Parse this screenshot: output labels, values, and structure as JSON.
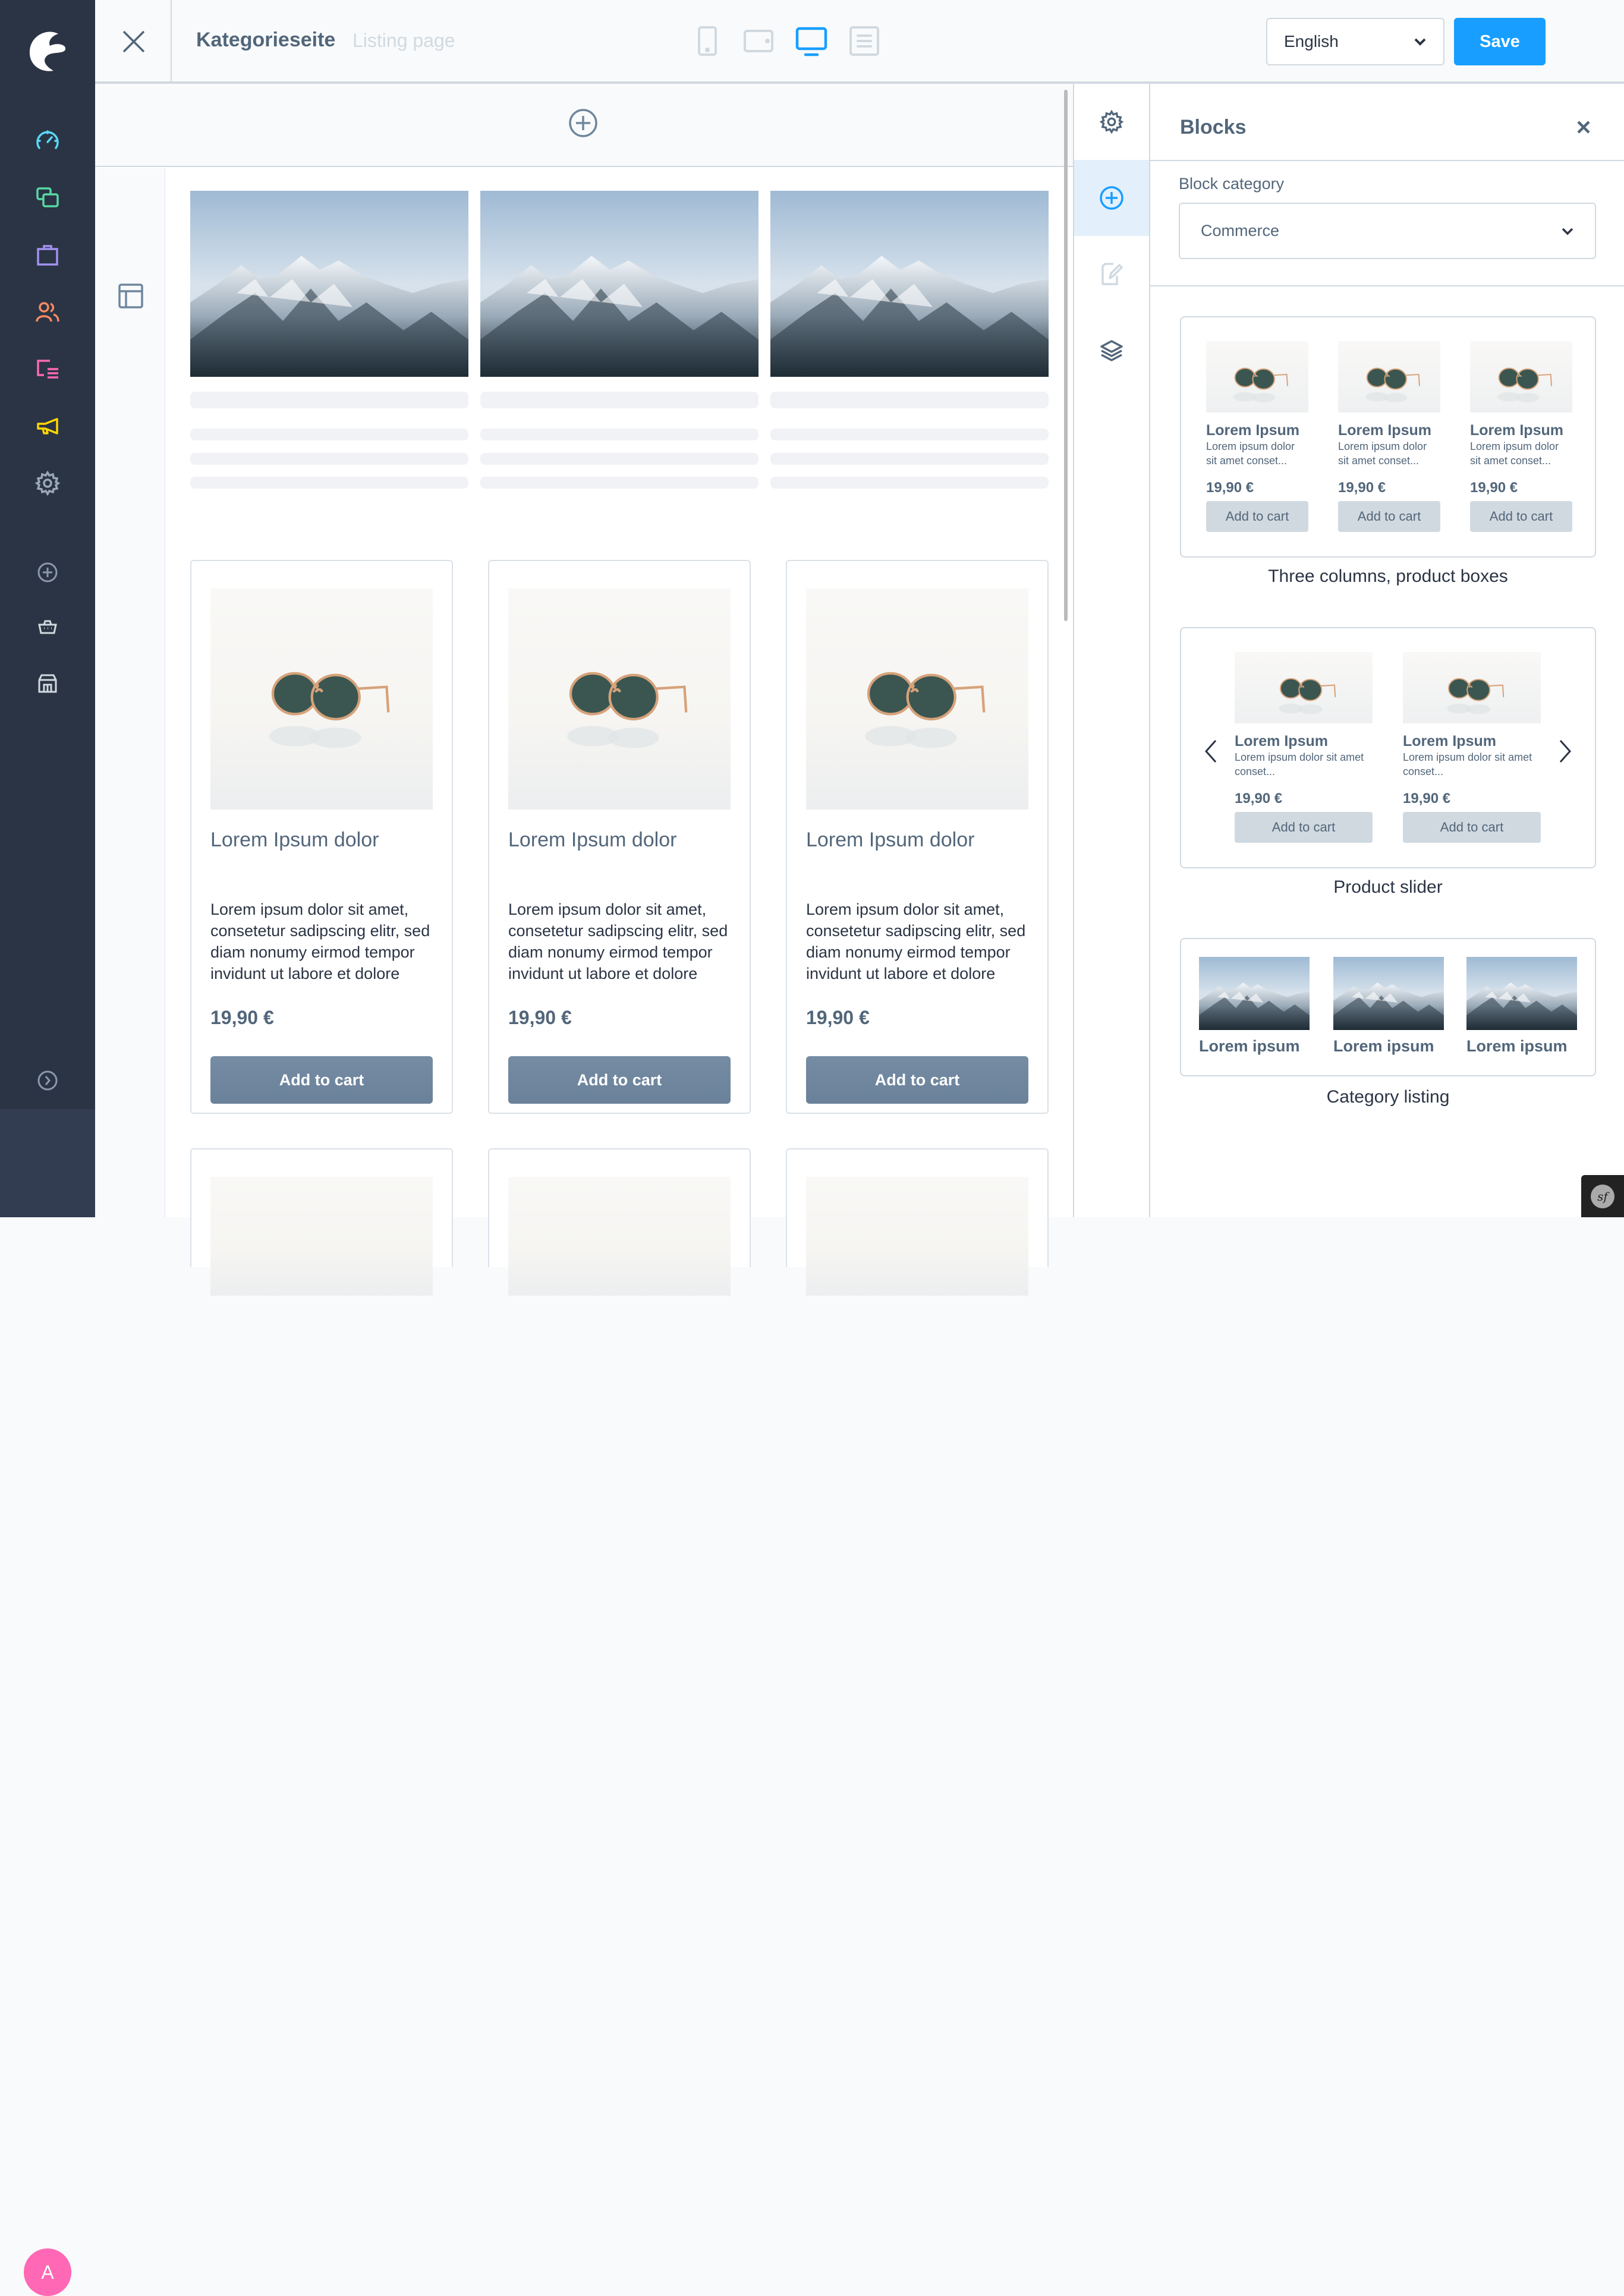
{
  "app": {
    "sidebar": {
      "items": [
        {
          "icon": "dashboard-icon",
          "color": "#57d9f8"
        },
        {
          "icon": "catalogue-icon",
          "color": "#57d9a3"
        },
        {
          "icon": "orders-icon",
          "color": "#a092f0"
        },
        {
          "icon": "customers-icon",
          "color": "#f88962"
        },
        {
          "icon": "content-icon",
          "color": "#ff68b4"
        },
        {
          "icon": "marketing-icon",
          "color": "#ffd700"
        },
        {
          "icon": "settings-icon",
          "color": "#9aa8b5"
        }
      ],
      "secondary": [
        {
          "icon": "add-icon"
        },
        {
          "icon": "basket-icon"
        },
        {
          "icon": "storefront-icon"
        }
      ],
      "collapse_icon": "chevron-right-circle-icon",
      "avatar_initial": "A",
      "avatar_color": "#ff68b4"
    },
    "topbar": {
      "title": "Kategorieseite",
      "subtitle": "Listing page",
      "devices": [
        {
          "name": "mobile",
          "active": false
        },
        {
          "name": "tablet",
          "active": false
        },
        {
          "name": "desktop",
          "active": true
        },
        {
          "name": "form",
          "active": false
        }
      ],
      "language": "English",
      "save_label": "Save",
      "accent": "#189eff"
    },
    "canvas": {
      "product_cards": [
        {
          "name": "Lorem Ipsum dolor",
          "description": "Lorem ipsum dolor sit amet, consetetur sadipscing elitr, sed diam nonumy eirmod tempor invidunt ut labore et dolore",
          "price": "19,90 €",
          "button": "Add to cart"
        },
        {
          "name": "Lorem Ipsum dolor",
          "description": "Lorem ipsum dolor sit amet, consetetur sadipscing elitr, sed diam nonumy eirmod tempor invidunt ut labore et dolore",
          "price": "19,90 €",
          "button": "Add to cart"
        },
        {
          "name": "Lorem Ipsum dolor",
          "description": "Lorem ipsum dolor sit amet, consetetur sadipscing elitr, sed diam nonumy eirmod tempor invidunt ut labore et dolore",
          "price": "19,90 €",
          "button": "Add to cart"
        }
      ]
    },
    "tools": [
      {
        "icon": "settings-icon",
        "active": false
      },
      {
        "icon": "add-block-icon",
        "active": true
      },
      {
        "icon": "edit-icon",
        "active": false
      },
      {
        "icon": "layers-icon",
        "active": false
      }
    ],
    "blocks_panel": {
      "title": "Blocks",
      "category_label": "Block category",
      "category_value": "Commerce",
      "previews": [
        {
          "caption": "Three columns, product boxes",
          "items": [
            {
              "name": "Lorem Ipsum",
              "desc": "Lorem ipsum dolor sit amet conset...",
              "price": "19,90 €",
              "button": "Add to cart"
            },
            {
              "name": "Lorem Ipsum",
              "desc": "Lorem ipsum dolor sit amet conset...",
              "price": "19,90 €",
              "button": "Add to cart"
            },
            {
              "name": "Lorem Ipsum",
              "desc": "Lorem ipsum dolor sit amet conset...",
              "price": "19,90 €",
              "button": "Add to cart"
            }
          ]
        },
        {
          "caption": "Product slider",
          "items": [
            {
              "name": "Lorem Ipsum",
              "desc": "Lorem ipsum dolor sit amet conset...",
              "price": "19,90 €",
              "button": "Add to cart"
            },
            {
              "name": "Lorem Ipsum",
              "desc": "Lorem ipsum dolor sit amet conset...",
              "price": "19,90 €",
              "button": "Add to cart"
            }
          ]
        },
        {
          "caption": "Category listing",
          "items": [
            {
              "name": "Lorem ipsum"
            },
            {
              "name": "Lorem ipsum"
            },
            {
              "name": "Lorem ipsum"
            }
          ]
        }
      ]
    },
    "debug_badge": "sf"
  }
}
